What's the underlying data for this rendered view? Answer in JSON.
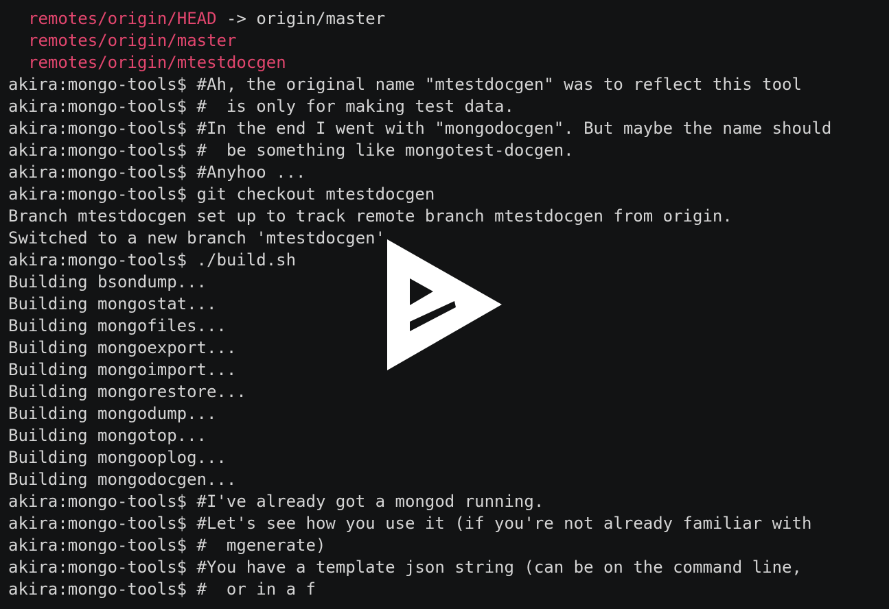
{
  "terminal": {
    "branches": [
      {
        "name": "remotes/origin/HEAD",
        "suffix": " -> origin/master"
      },
      {
        "name": "remotes/origin/master",
        "suffix": ""
      },
      {
        "name": "remotes/origin/mtestdocgen",
        "suffix": ""
      }
    ],
    "lines": [
      {
        "prompt": "akira:mongo-tools$ ",
        "text": "#Ah, the original name \"mtestdocgen\" was to reflect this tool"
      },
      {
        "prompt": "akira:mongo-tools$ ",
        "text": "#  is only for making test data."
      },
      {
        "prompt": "akira:mongo-tools$ ",
        "text": "#In the end I went with \"mongodocgen\". But maybe the name should"
      },
      {
        "prompt": "akira:mongo-tools$ ",
        "text": "#  be something like mongotest-docgen."
      },
      {
        "prompt": "akira:mongo-tools$ ",
        "text": "#Anyhoo ..."
      },
      {
        "prompt": "akira:mongo-tools$ ",
        "text": "git checkout mtestdocgen"
      },
      {
        "prompt": "",
        "text": "Branch mtestdocgen set up to track remote branch mtestdocgen from origin."
      },
      {
        "prompt": "",
        "text": "Switched to a new branch 'mtestdocgen'"
      },
      {
        "prompt": "akira:mongo-tools$ ",
        "text": "./build.sh"
      },
      {
        "prompt": "",
        "text": "Building bsondump..."
      },
      {
        "prompt": "",
        "text": "Building mongostat..."
      },
      {
        "prompt": "",
        "text": "Building mongofiles..."
      },
      {
        "prompt": "",
        "text": "Building mongoexport..."
      },
      {
        "prompt": "",
        "text": "Building mongoimport..."
      },
      {
        "prompt": "",
        "text": "Building mongorestore..."
      },
      {
        "prompt": "",
        "text": "Building mongodump..."
      },
      {
        "prompt": "",
        "text": "Building mongotop..."
      },
      {
        "prompt": "",
        "text": "Building mongooplog..."
      },
      {
        "prompt": "",
        "text": "Building mongodocgen..."
      },
      {
        "prompt": "akira:mongo-tools$ ",
        "text": "#I've already got a mongod running."
      },
      {
        "prompt": "akira:mongo-tools$ ",
        "text": "#Let's see how you use it (if you're not already familiar with"
      },
      {
        "prompt": "akira:mongo-tools$ ",
        "text": "#  mgenerate)"
      },
      {
        "prompt": "akira:mongo-tools$ ",
        "text": "#You have a template json string (can be on the command line,"
      },
      {
        "prompt": "akira:mongo-tools$ ",
        "text": "#  or in a f"
      }
    ]
  },
  "overlay": {
    "icon": "asciinema-play-icon",
    "color": "#ffffff"
  },
  "colors": {
    "background": "#121314",
    "text": "#d4d4d4",
    "remote_branch": "#e2466e"
  }
}
